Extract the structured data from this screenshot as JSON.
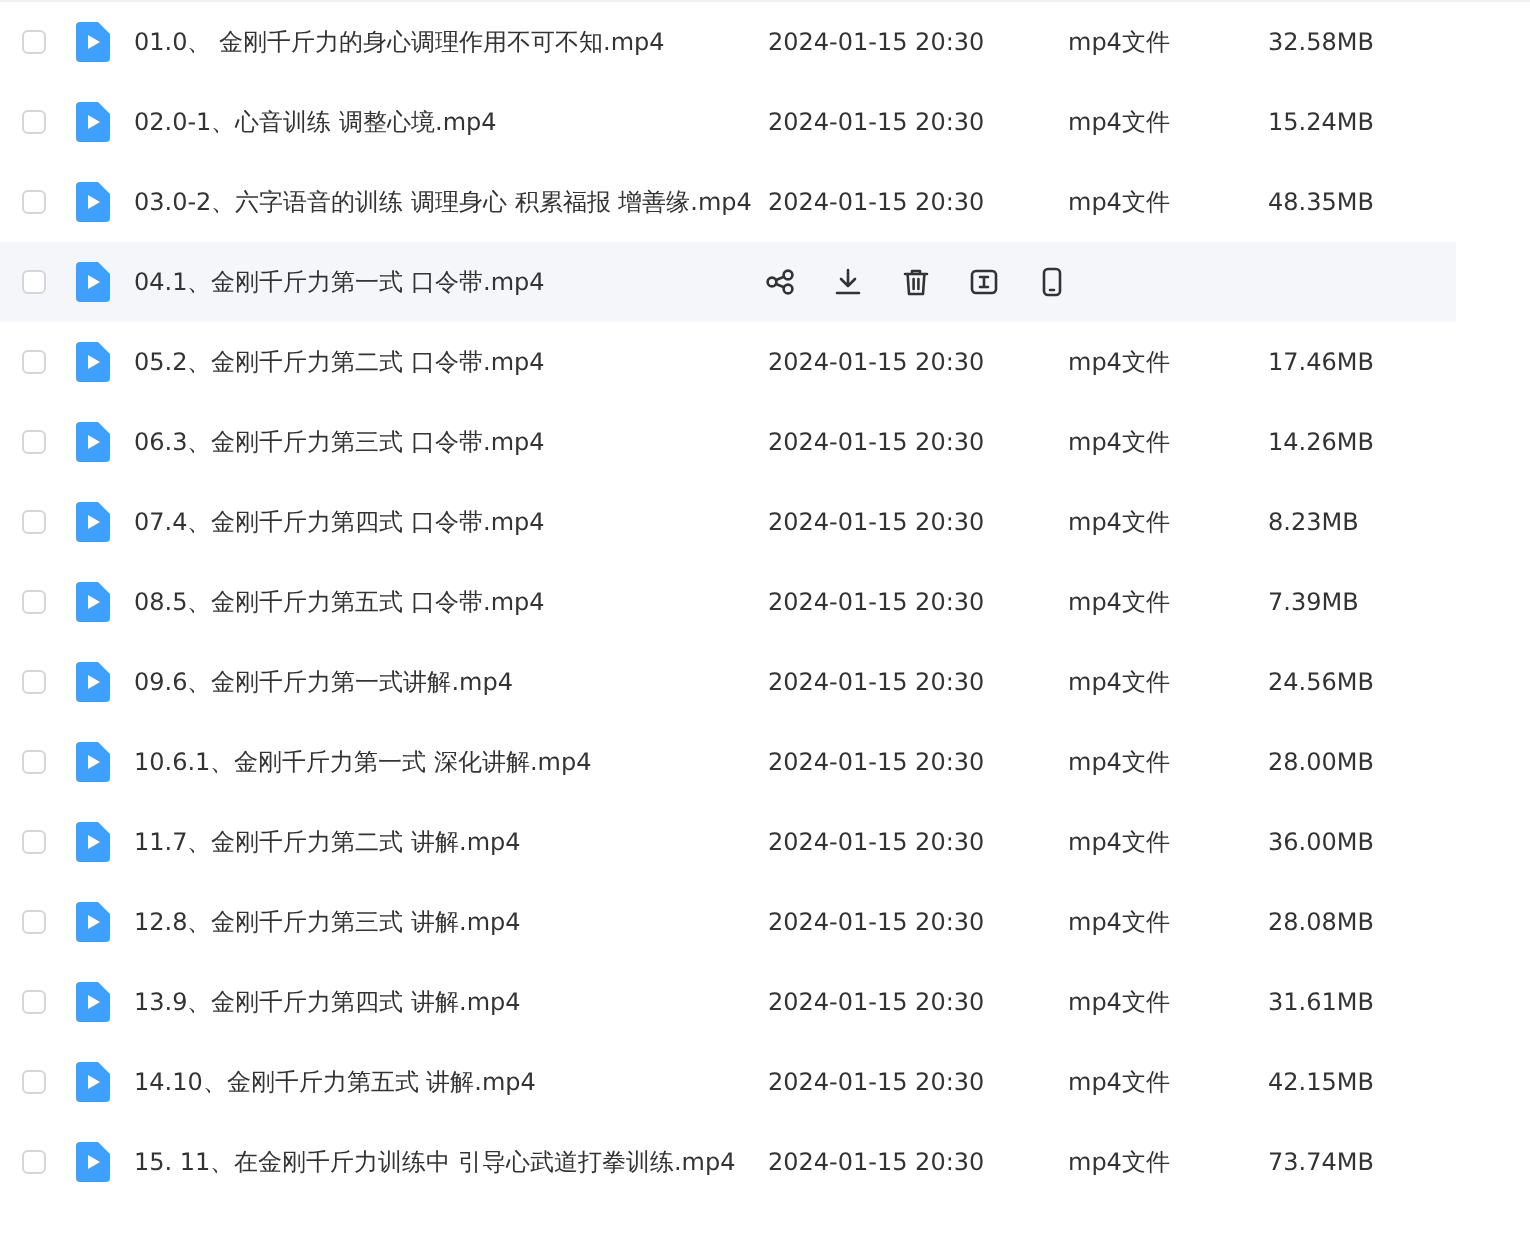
{
  "files": [
    {
      "name": "01.0、 金刚千斤力的身心调理作用不可不知.mp4",
      "date": "2024-01-15 20:30",
      "type": "mp4文件",
      "size": "32.58MB",
      "checked": false,
      "hovered": false
    },
    {
      "name": "02.0-1、心音训练 调整心境.mp4",
      "date": "2024-01-15 20:30",
      "type": "mp4文件",
      "size": "15.24MB",
      "checked": false,
      "hovered": false
    },
    {
      "name": "03.0-2、六字语音的训练 调理身心 积累福报 增善缘.mp4",
      "date": "2024-01-15 20:30",
      "type": "mp4文件",
      "size": "48.35MB",
      "checked": false,
      "hovered": false
    },
    {
      "name": "04.1、金刚千斤力第一式 口令带.mp4",
      "checked": false,
      "hovered": true,
      "actions": [
        {
          "kind": "share"
        },
        {
          "kind": "download"
        },
        {
          "kind": "delete"
        },
        {
          "kind": "rename"
        },
        {
          "kind": "phone"
        }
      ]
    },
    {
      "name": "05.2、金刚千斤力第二式 口令带.mp4",
      "date": "2024-01-15 20:30",
      "type": "mp4文件",
      "size": "17.46MB",
      "checked": false,
      "hovered": false
    },
    {
      "name": "06.3、金刚千斤力第三式 口令带.mp4",
      "date": "2024-01-15 20:30",
      "type": "mp4文件",
      "size": "14.26MB",
      "checked": false,
      "hovered": false
    },
    {
      "name": "07.4、金刚千斤力第四式 口令带.mp4",
      "date": "2024-01-15 20:30",
      "type": "mp4文件",
      "size": "8.23MB",
      "checked": false,
      "hovered": false
    },
    {
      "name": "08.5、金刚千斤力第五式 口令带.mp4",
      "date": "2024-01-15 20:30",
      "type": "mp4文件",
      "size": "7.39MB",
      "checked": false,
      "hovered": false
    },
    {
      "name": "09.6、金刚千斤力第一式讲解.mp4",
      "date": "2024-01-15 20:30",
      "type": "mp4文件",
      "size": "24.56MB",
      "checked": false,
      "hovered": false
    },
    {
      "name": "10.6.1、金刚千斤力第一式 深化讲解.mp4",
      "date": "2024-01-15 20:30",
      "type": "mp4文件",
      "size": "28.00MB",
      "checked": false,
      "hovered": false
    },
    {
      "name": "11.7、金刚千斤力第二式 讲解.mp4",
      "date": "2024-01-15 20:30",
      "type": "mp4文件",
      "size": "36.00MB",
      "checked": false,
      "hovered": false
    },
    {
      "name": "12.8、金刚千斤力第三式 讲解.mp4",
      "date": "2024-01-15 20:30",
      "type": "mp4文件",
      "size": "28.08MB",
      "checked": false,
      "hovered": false
    },
    {
      "name": "13.9、金刚千斤力第四式 讲解.mp4",
      "date": "2024-01-15 20:30",
      "type": "mp4文件",
      "size": "31.61MB",
      "checked": false,
      "hovered": false
    },
    {
      "name": "14.10、金刚千斤力第五式 讲解.mp4",
      "date": "2024-01-15 20:30",
      "type": "mp4文件",
      "size": "42.15MB",
      "checked": false,
      "hovered": false
    },
    {
      "name": "15. 11、在金刚千斤力训练中 引导心武道打拳训练.mp4",
      "date": "2024-01-15 20:30",
      "type": "mp4文件",
      "size": "73.74MB",
      "checked": false,
      "hovered": false
    }
  ]
}
